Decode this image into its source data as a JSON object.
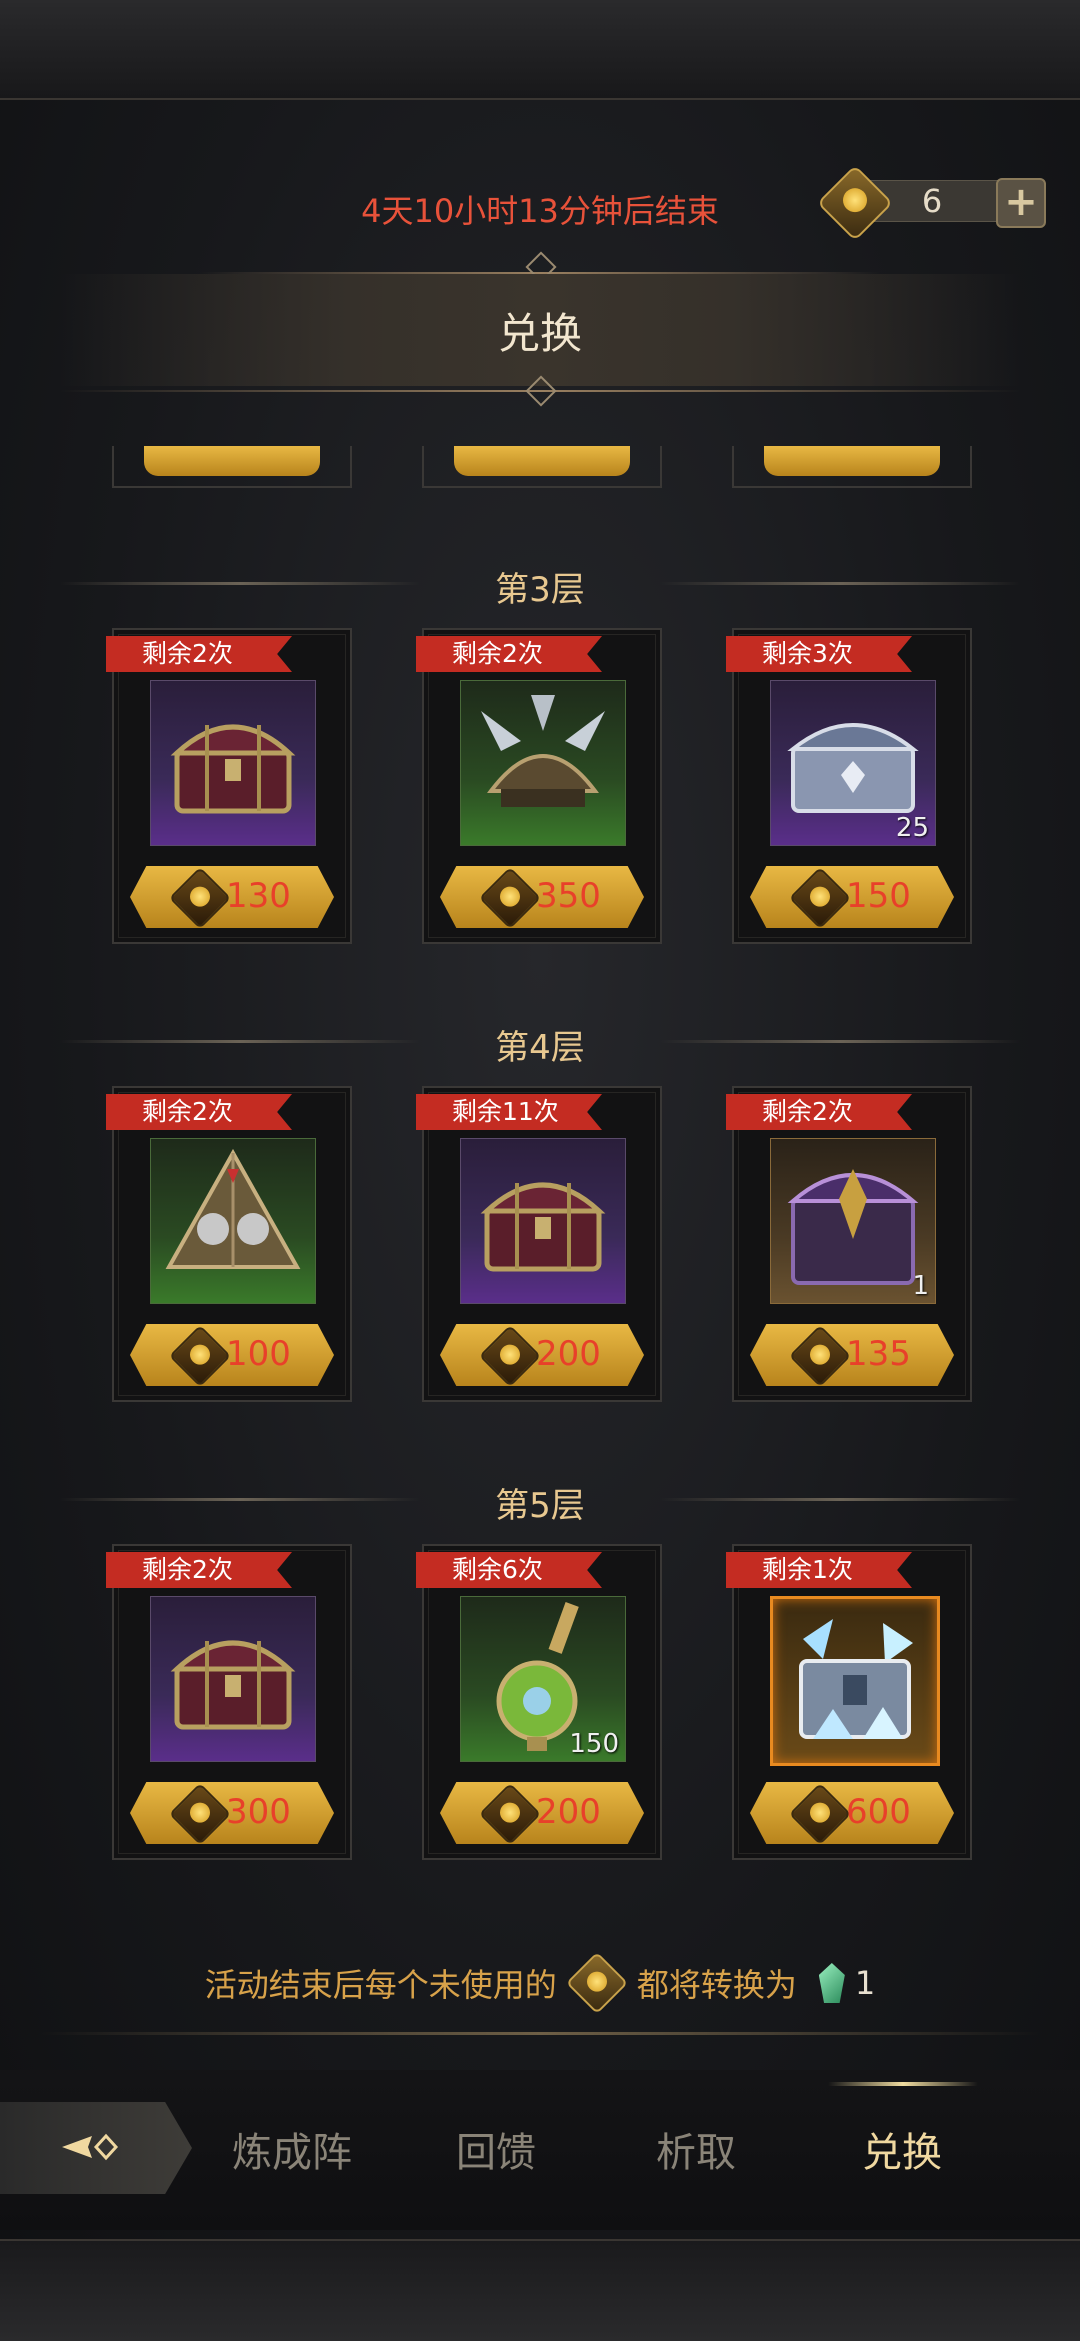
{
  "header": {
    "timer_text": "4天10小时13分钟后结束",
    "currency_value": "6",
    "title": "兑换"
  },
  "layers": [
    {
      "title": "第3层",
      "items": [
        {
          "remaining": "剩余2次",
          "icon": "treasure-chest-icon",
          "bg": "purple",
          "qty": "",
          "price": "130"
        },
        {
          "remaining": "剩余2次",
          "icon": "spiked-helmet-icon",
          "bg": "green",
          "qty": "",
          "price": "350"
        },
        {
          "remaining": "剩余3次",
          "icon": "silver-chest-icon",
          "bg": "purple",
          "qty": "25",
          "price": "150"
        }
      ]
    },
    {
      "title": "第4层",
      "items": [
        {
          "remaining": "剩余2次",
          "icon": "skull-pyramid-icon",
          "bg": "green",
          "qty": "",
          "price": "100"
        },
        {
          "remaining": "剩余11次",
          "icon": "treasure-chest-icon",
          "bg": "purple",
          "qty": "",
          "price": "200"
        },
        {
          "remaining": "剩余2次",
          "icon": "dark-chest-icon",
          "bg": "brown",
          "qty": "1",
          "price": "135"
        }
      ]
    },
    {
      "title": "第5层",
      "items": [
        {
          "remaining": "剩余2次",
          "icon": "treasure-chest-icon",
          "bg": "purple",
          "qty": "",
          "price": "300"
        },
        {
          "remaining": "剩余6次",
          "icon": "potion-flask-icon",
          "bg": "green",
          "qty": "150",
          "price": "200"
        },
        {
          "remaining": "剩余1次",
          "icon": "crystal-chest-icon",
          "bg": "gold",
          "qty": "",
          "price": "600"
        }
      ]
    }
  ],
  "footer_note": {
    "prefix": "活动结束后每个未使用的",
    "middle": "都将转换为",
    "amount": "1"
  },
  "nav": {
    "tabs": [
      "炼成阵",
      "回馈",
      "析取",
      "兑换"
    ],
    "active": "兑换"
  },
  "colors": {
    "timer": "#e8523a",
    "price_text": "#e8402a",
    "ribbon": "#c42c22",
    "accent_gold": "#e8b844"
  }
}
